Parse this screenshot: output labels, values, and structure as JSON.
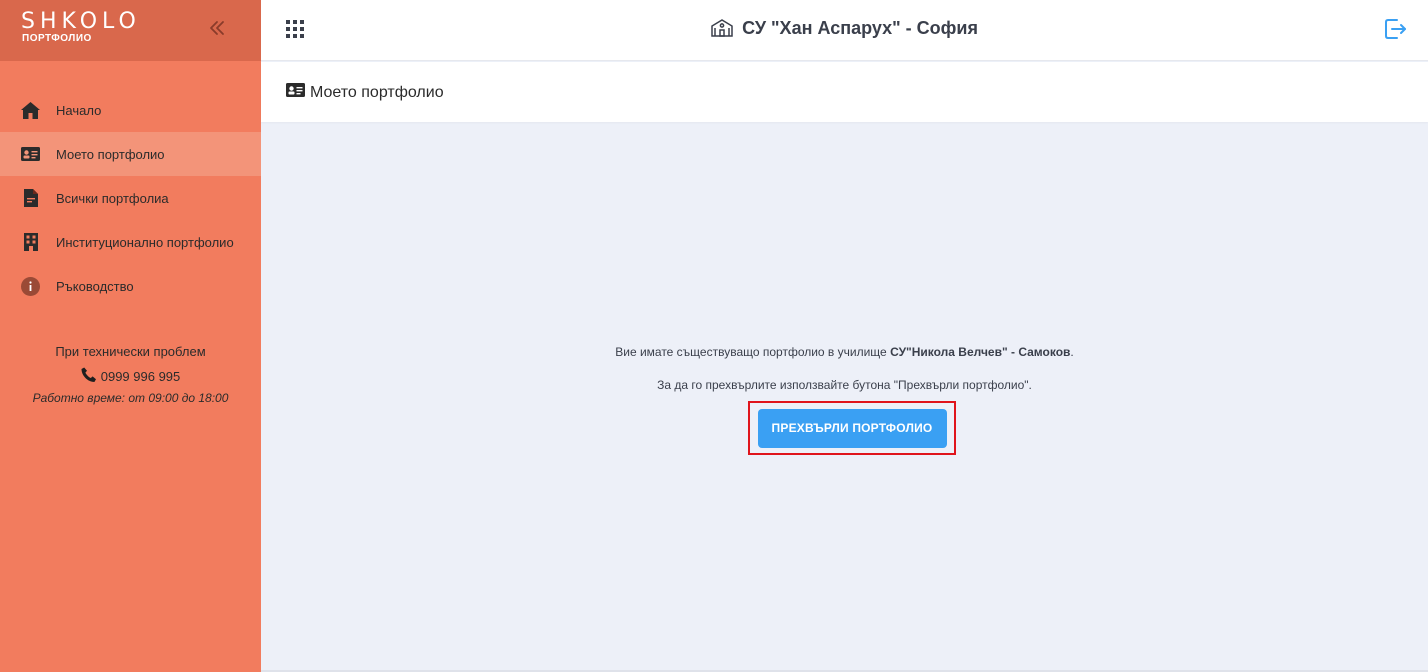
{
  "brand": {
    "logo": "SHKOLO",
    "subtitle": "ПОРТФОЛИО"
  },
  "header": {
    "school": "СУ \"Хан Аспарух\" - София"
  },
  "sidebar": {
    "items": [
      {
        "label": "Начало",
        "icon": "home-icon"
      },
      {
        "label": "Моето портфолио",
        "icon": "id-card-icon",
        "active": true
      },
      {
        "label": "Всички портфолиа",
        "icon": "file-icon"
      },
      {
        "label": "Институционално портфолио",
        "icon": "building-icon"
      },
      {
        "label": "Ръководство",
        "icon": "info-icon"
      }
    ],
    "support": {
      "text": "При технически проблем",
      "phone": "0999 996 995",
      "hours": "Работно време: от 09:00 до 18:00"
    }
  },
  "page": {
    "title": "Моето портфолио"
  },
  "main": {
    "message_prefix": "Вие имате съществуващо портфолио в училище ",
    "message_school": "СУ\"Никола Велчев\" - Самоков",
    "message_suffix": ".",
    "instruction": "За да го прехвърлите използвайте бутона \"Прехвърли портфолио\".",
    "button_label": "ПРЕХВЪРЛИ ПОРТФОЛИО"
  },
  "colors": {
    "sidebar": "#f27c5e",
    "brand": "#d9684c",
    "accent": "#3aa0f3",
    "highlight": "#e0141c"
  }
}
